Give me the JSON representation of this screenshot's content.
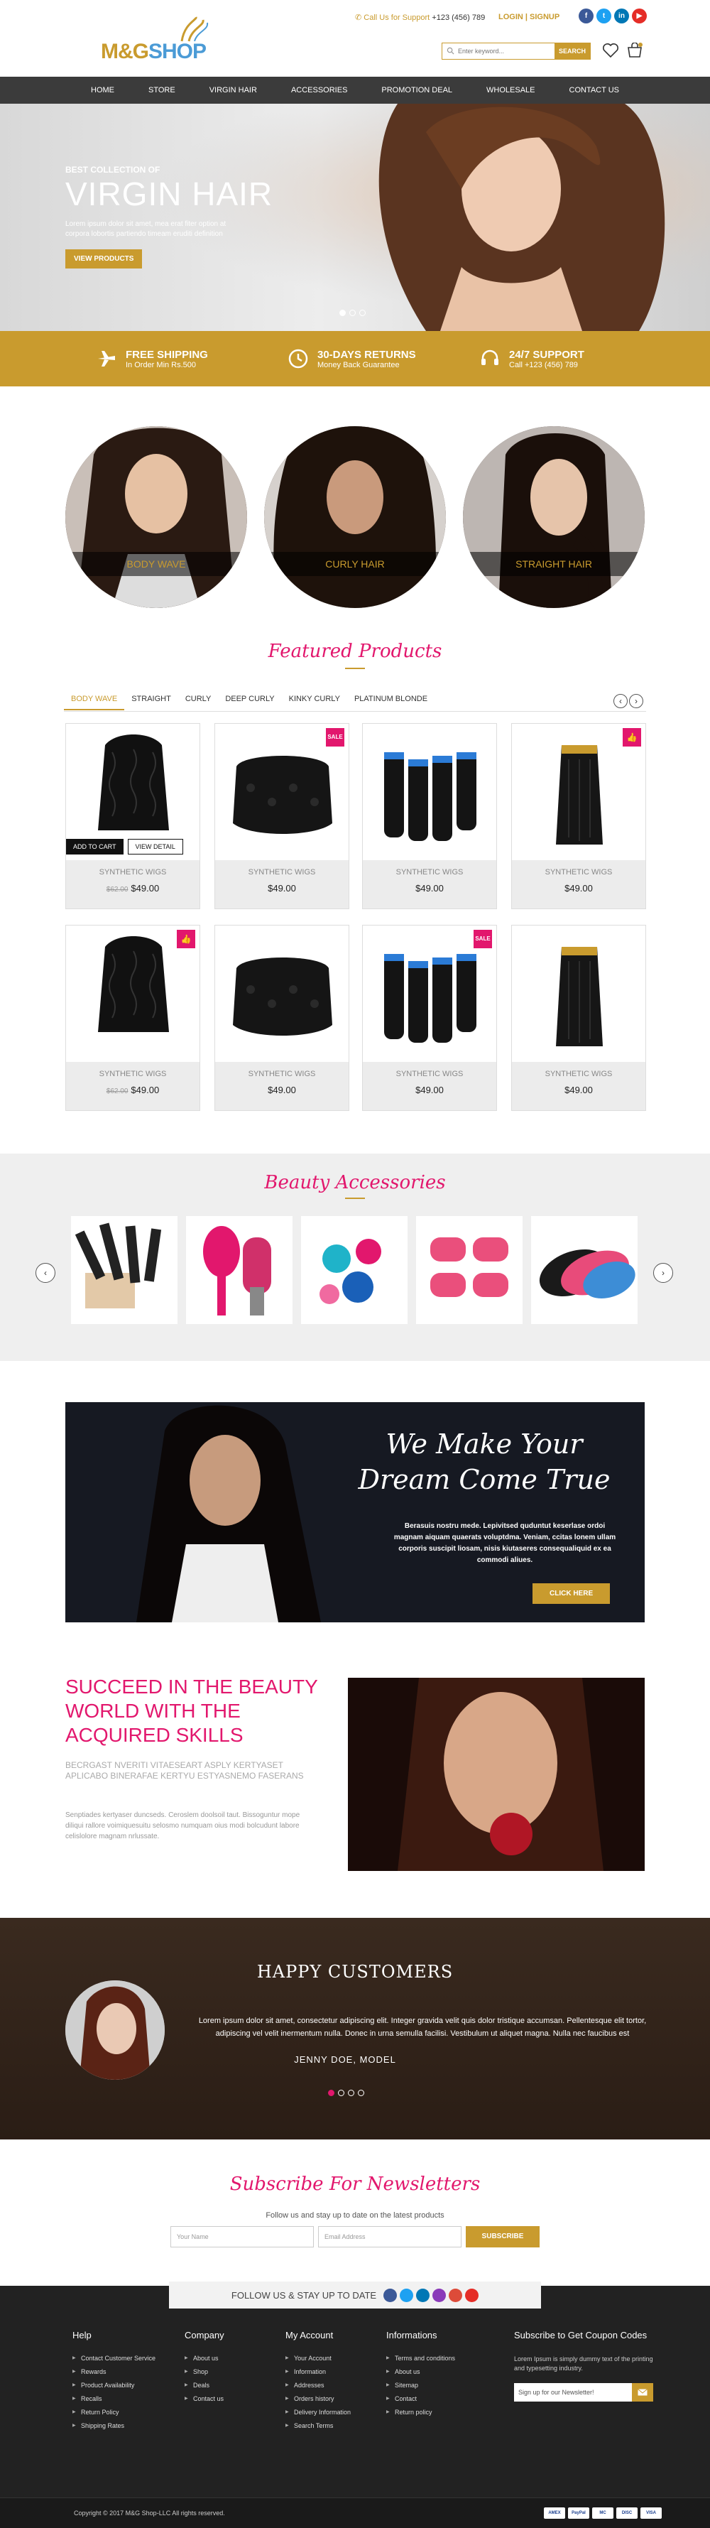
{
  "header": {
    "logo_text_1": "M&G",
    "logo_text_2": "SHOP",
    "support_label": "Call Us for Support",
    "support_phone": "+123 (456) 789",
    "login": "LOGIN | SIGNUP",
    "search_placeholder": "Enter keyword...",
    "search_button": "SEARCH",
    "socials": [
      {
        "icon": "facebook-icon",
        "glyph": "f",
        "color": "#3b5998"
      },
      {
        "icon": "twitter-icon",
        "glyph": "t",
        "color": "#1da1f2"
      },
      {
        "icon": "linkedin-icon",
        "glyph": "in",
        "color": "#0077b5"
      },
      {
        "icon": "youtube-icon",
        "glyph": "▶",
        "color": "#e52d27"
      }
    ]
  },
  "nav": [
    "HOME",
    "STORE",
    "VIRGIN HAIR",
    "ACCESSORIES",
    "PROMOTION DEAL",
    "WHOLESALE",
    "CONTACT US"
  ],
  "hero": {
    "subtitle": "BEST COLLECTION OF",
    "title": "VIRGIN HAIR",
    "text": "Lorem ipsum dolor sit amet, mea erat fiter option at corpora lobortis partiendo timeam eruditi definition",
    "cta": "VIEW PRODUCTS"
  },
  "features": [
    {
      "icon": "plane-icon",
      "title": "FREE SHIPPING",
      "sub": "In Order Min Rs.500"
    },
    {
      "icon": "clock-icon",
      "title": "30-DAYS RETURNS",
      "sub": "Money Back  Guarantee"
    },
    {
      "icon": "support-icon",
      "title": "24/7 SUPPORT",
      "sub": "Call +123 (456) 789"
    }
  ],
  "categories": [
    "BODY WAVE",
    "CURLY HAIR",
    "STRAIGHT HAIR"
  ],
  "featured": {
    "title": "Featured Products",
    "tabs": [
      "BODY WAVE",
      "STRAIGHT",
      "CURLY",
      "DEEP CURLY",
      "KINKY CURLY",
      "PLATINUM BLONDE"
    ],
    "add_to_cart": "ADD TO CART",
    "view_detail": "VIEW DETAIL",
    "badge_sale": "SALE",
    "products": [
      {
        "name": "SYNTHETIC WIGS",
        "old": "$62.00",
        "price": "$49.00"
      },
      {
        "name": "SYNTHETIC WIGS",
        "old": "",
        "price": "$49.00"
      },
      {
        "name": "SYNTHETIC WIGS",
        "old": "",
        "price": "$49.00"
      },
      {
        "name": "SYNTHETIC WIGS",
        "old": "",
        "price": "$49.00"
      },
      {
        "name": "SYNTHETIC WIGS",
        "old": "$62.00",
        "price": "$49.00"
      },
      {
        "name": "SYNTHETIC WIGS",
        "old": "",
        "price": "$49.00"
      },
      {
        "name": "SYNTHETIC WIGS",
        "old": "",
        "price": "$49.00"
      },
      {
        "name": "SYNTHETIC WIGS",
        "old": "",
        "price": "$49.00"
      }
    ]
  },
  "beauty": {
    "title": "Beauty Accessories"
  },
  "banner": {
    "title_line1": "We Make Your",
    "title_line2": "Dream Come True",
    "text": "Berasuis nostru mede. Lepivitsed quduntut keserlase ordoi magnam aiquam quaerats voluptdma. Veniam, ccitas lonem ullam corporis suscipit liosam, nisis kiutaseres consequaliquid ex ea commodi aliues.",
    "cta": "CLICK HERE"
  },
  "succeed": {
    "title": "SUCCEED IN THE BEAUTY WORLD WITH THE ACQUIRED SKILLS",
    "sub": "BECRGAST NVERITI VITAESEART ASPLY KERTYASET APLICABO BINERAFAE KERTYU ESTYASNEMO FASERANS",
    "text": "Senptiades kertyaser duncseds. Ceroslem doolsoil taut. Bissoguntur mope diliqui rallore voimiquesuitu selosmo numquam oius modi bolcudunt labore celislolore magnam nrlussate."
  },
  "testimonial": {
    "title": "HAPPY CUSTOMERS",
    "text": "Lorem ipsum dolor sit amet, consectetur adipiscing elit. Integer gravida velit quis dolor tristique accumsan. Pellentesque elit tortor, adipiscing vel velit inermentum nulla. Donec in urna semulla facilisi. Vestibulum ut aliquet magna. Nulla nec faucibus est",
    "author": "JENNY DOE, MODEL"
  },
  "newsletter": {
    "title": "Subscribe For Newsletters",
    "sub": "Follow us and stay up to date on the latest products",
    "name_placeholder": "Your Name",
    "email_placeholder": "Email Address",
    "button": "SUBSCRIBE"
  },
  "follow": {
    "label": "FOLLOW US & STAY UP TO DATE"
  },
  "footer": {
    "help": {
      "title": "Help",
      "items": [
        "Contact Customer Service",
        "Rewards",
        "Product Availability",
        "Recalls",
        "Return Policy",
        "Shipping Rates"
      ]
    },
    "company": {
      "title": "Company",
      "items": [
        "About us",
        "Shop",
        "Deals",
        "Contact us"
      ]
    },
    "account": {
      "title": "My Account",
      "items": [
        "Your Account",
        "Information",
        "Addresses",
        "Orders history",
        "Delivery Information",
        "Search Terms"
      ]
    },
    "info": {
      "title": "Informations",
      "items": [
        "Terms and conditions",
        "About us",
        "Sitemap",
        "Contact",
        "Return policy"
      ]
    },
    "coupon": {
      "title": "Subscribe to Get Coupon Codes",
      "text": "Lorem Ipsum is simply dummy text of the printing and typesetting industry.",
      "placeholder": "Sign up for our Newsletter!"
    },
    "copyright": "Copyright © 2017 M&G Shop-LLC All rights reserved.",
    "payments": [
      "AMEX",
      "PayPal",
      "MC",
      "DISC",
      "VISA"
    ]
  },
  "colors": {
    "gold": "#c99b2e",
    "pink": "#e2176d",
    "nav": "#3b3b3b",
    "footer": "#222222"
  }
}
